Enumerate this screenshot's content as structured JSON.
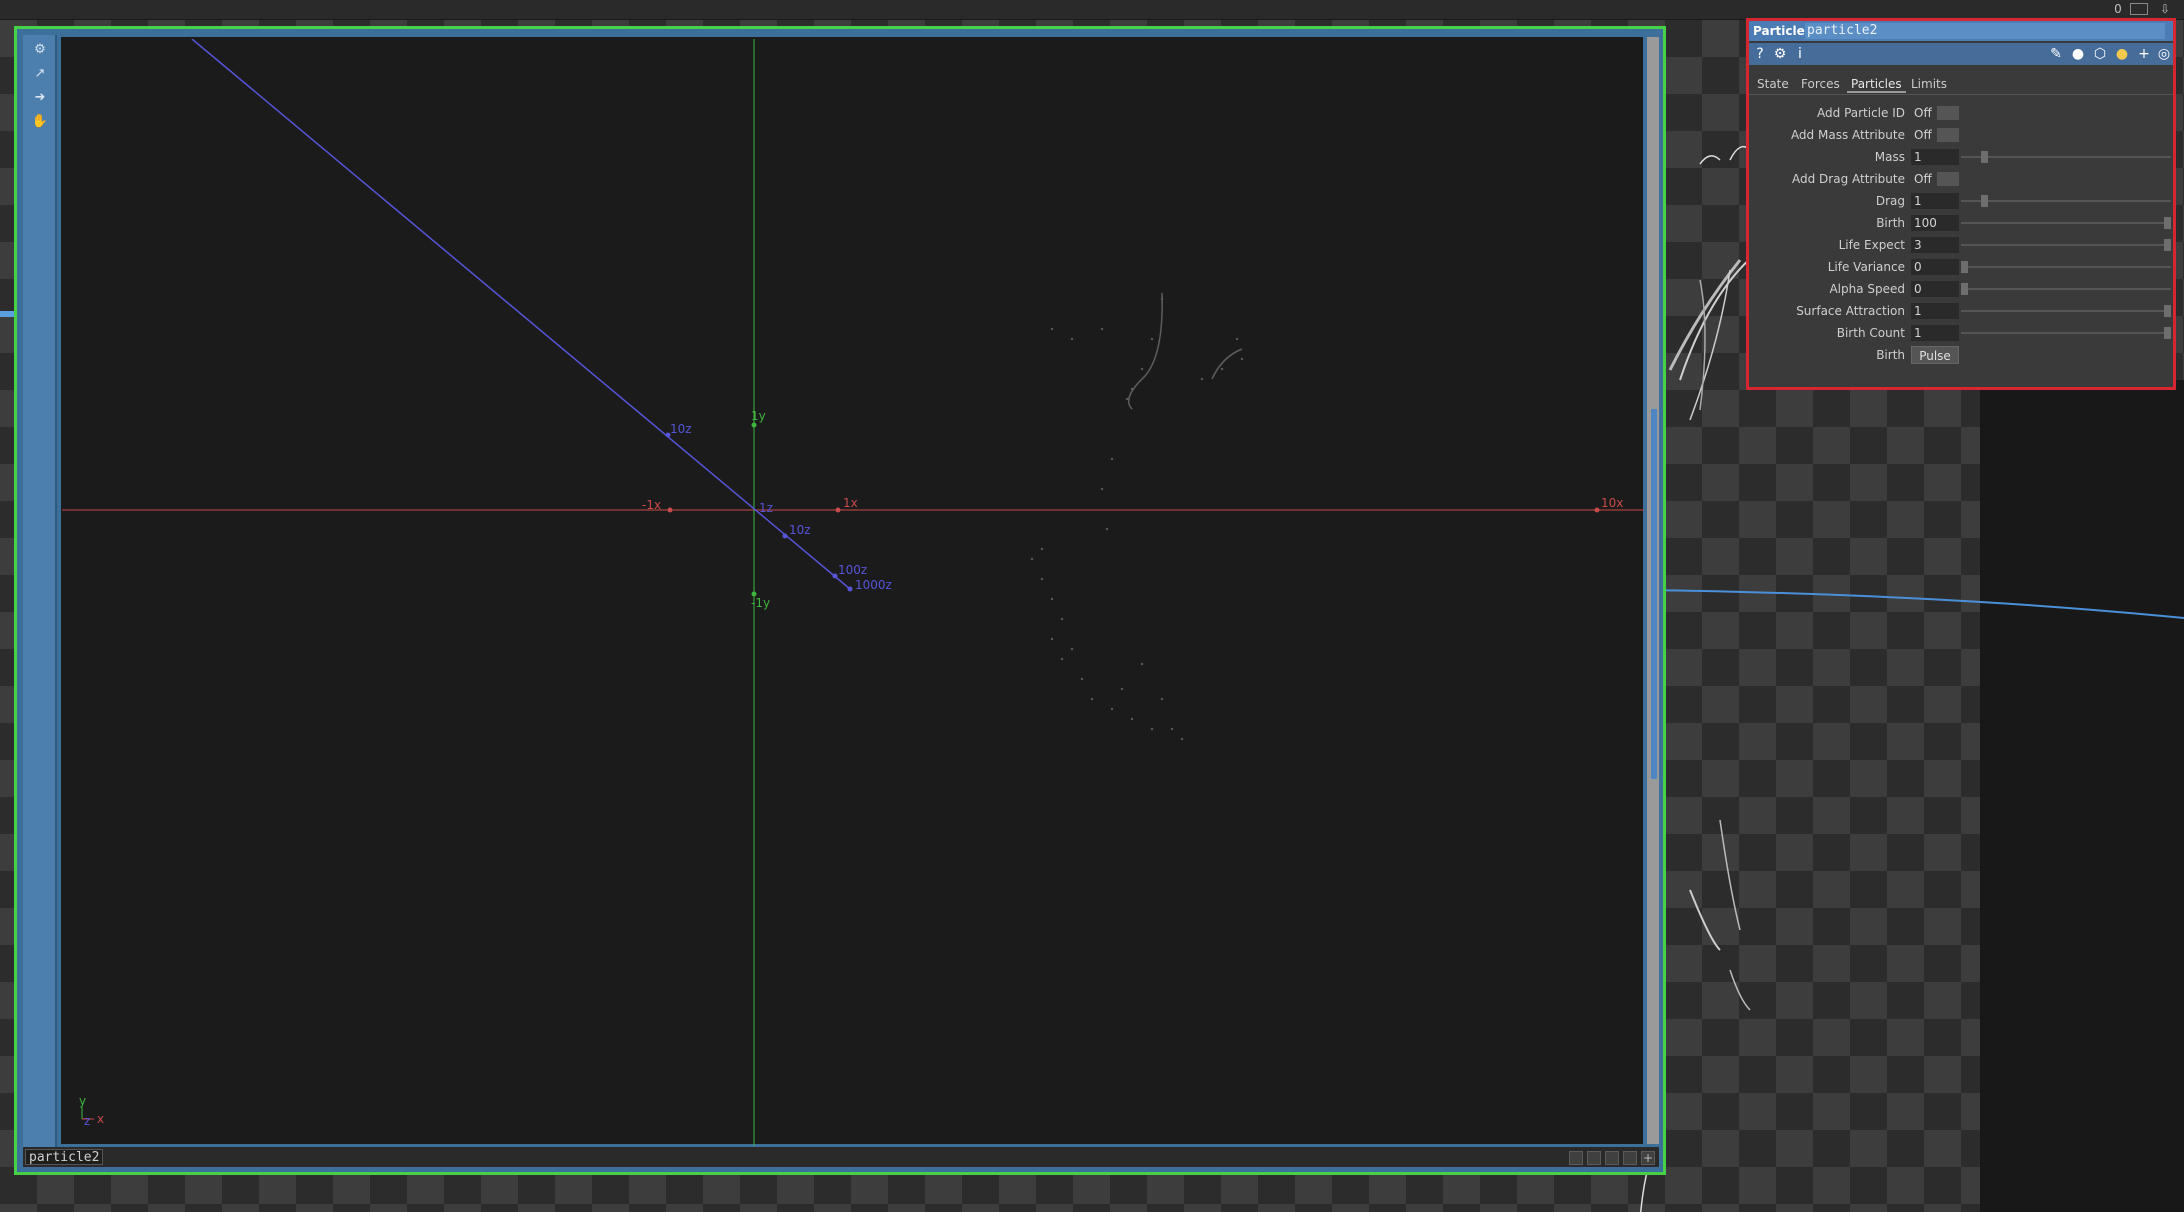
{
  "topbar": {
    "counter": "0",
    "window_icon": "window-icon",
    "collapse_icon": "arrow-down-icon"
  },
  "viewer": {
    "node_name": "particle2",
    "tool_icons": [
      "gear-icon",
      "graph-icon",
      "arrow-right-icon",
      "hand-icon"
    ],
    "axis_labels": {
      "y_pos": "1y",
      "y_neg": "-1y",
      "x_pos": "1x",
      "x_neg": "-1x",
      "x_far": "10x",
      "z_back": "10z",
      "z_near": "10z",
      "z_100": "100z",
      "z_1000": "1000z",
      "origin": "1z"
    },
    "gizmo": {
      "y": "y",
      "x": "x",
      "z": "z"
    },
    "colors": {
      "x_axis": "#c94a4a",
      "y_axis": "#3fb43f",
      "z_axis": "#5555d8",
      "frame": "#46d146"
    }
  },
  "panel": {
    "type": "Particle",
    "name": "particle2",
    "toolbar_icons": [
      "help-icon",
      "python-icon",
      "info-icon",
      "pencil-icon",
      "comment-icon",
      "tag-icon",
      "python-snake-icon",
      "plus-icon",
      "target-icon"
    ],
    "tabs": [
      "State",
      "Forces",
      "Particles",
      "Limits"
    ],
    "active_tab": "Particles",
    "params": [
      {
        "label": "Add Particle ID",
        "kind": "toggle",
        "value": "Off"
      },
      {
        "label": "Add Mass Attribute",
        "kind": "toggle",
        "value": "Off"
      },
      {
        "label": "Mass",
        "kind": "slider",
        "value": "1",
        "level": 0.1
      },
      {
        "label": "Add Drag Attribute",
        "kind": "toggle",
        "value": "Off"
      },
      {
        "label": "Drag",
        "kind": "slider",
        "value": "1",
        "level": 0.1
      },
      {
        "label": "Birth",
        "kind": "slider",
        "value": "100",
        "level": 1.0
      },
      {
        "label": "Life Expect",
        "kind": "slider",
        "value": "3",
        "level": 1.0
      },
      {
        "label": "Life Variance",
        "kind": "slider",
        "value": "0",
        "level": 0.0
      },
      {
        "label": "Alpha Speed",
        "kind": "slider",
        "value": "0",
        "level": 0.0
      },
      {
        "label": "Surface Attraction",
        "kind": "slider",
        "value": "1",
        "level": 1.0
      },
      {
        "label": "Birth Count",
        "kind": "slider",
        "value": "1",
        "level": 1.0
      },
      {
        "label": "Birth",
        "kind": "button",
        "value": "Pulse"
      }
    ]
  }
}
